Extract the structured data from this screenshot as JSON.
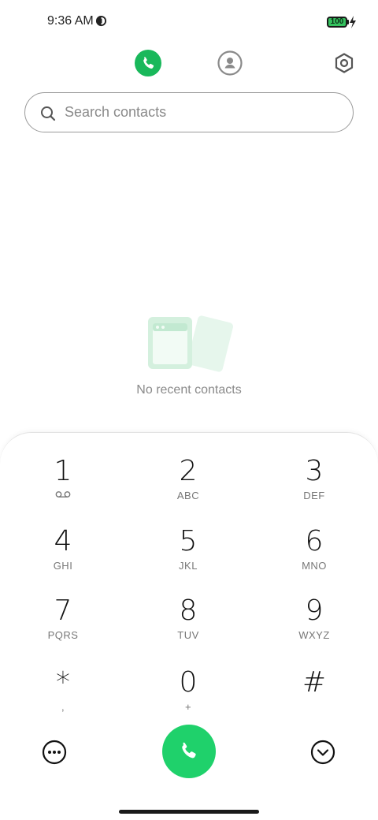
{
  "status_bar": {
    "time": "9:36 AM",
    "battery_level": "100"
  },
  "tabs": {
    "phone_icon": "phone-icon",
    "contacts_icon": "contacts-icon",
    "settings_icon": "settings-icon"
  },
  "search": {
    "placeholder": "Search contacts",
    "value": ""
  },
  "empty_state": {
    "message": "No recent contacts"
  },
  "dialpad": {
    "keys": [
      {
        "digit": "1",
        "letters": ""
      },
      {
        "digit": "2",
        "letters": "ABC"
      },
      {
        "digit": "3",
        "letters": "DEF"
      },
      {
        "digit": "4",
        "letters": "GHI"
      },
      {
        "digit": "5",
        "letters": "JKL"
      },
      {
        "digit": "6",
        "letters": "MNO"
      },
      {
        "digit": "7",
        "letters": "PQRS"
      },
      {
        "digit": "8",
        "letters": "TUV"
      },
      {
        "digit": "9",
        "letters": "WXYZ"
      },
      {
        "digit": "*",
        "letters": ","
      },
      {
        "digit": "0",
        "letters": "+"
      },
      {
        "digit": "#",
        "letters": ""
      }
    ]
  },
  "colors": {
    "accent": "#19b85b",
    "call_button": "#1fd16b"
  }
}
